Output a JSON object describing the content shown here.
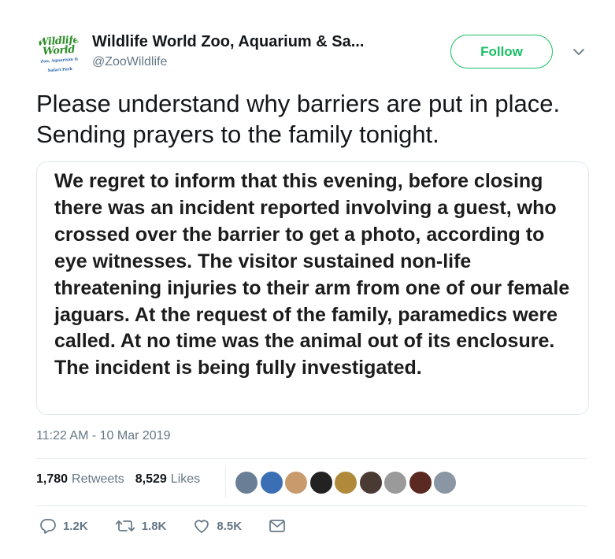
{
  "account": {
    "name": "Wildlife World Zoo, Aquarium & Sa...",
    "handle": "@ZooWildlife",
    "logo_text": "Wildlife World",
    "logo_subtext": "Zoo, Aquarium & Safari Park",
    "logo_color": "#2f8f2a"
  },
  "follow_button": {
    "label": "Follow",
    "color": "#17bf63"
  },
  "tweet": {
    "text": "Please understand why barriers are put in place. Sending prayers to the family tonight.",
    "image_text": "We regret to inform that this evening, before closing there was an incident reported involving a guest, who crossed over the barrier to get a photo, according to eye witnesses. The visitor sustained non-life threatening injuries to their arm from one of our female jaguars. At the request of the family, paramedics were called. At no time was the animal out of its enclosure.  The incident is being fully investigated.",
    "timestamp": "11:22 AM - 10 Mar 2019"
  },
  "stats": {
    "retweets_count": "1,780",
    "retweets_label": "Retweets",
    "likes_count": "8,529",
    "likes_label": "Likes",
    "liker_avatar_colors": [
      "#6a7f95",
      "#3a6fb5",
      "#c89a6c",
      "#222222",
      "#b08a3a",
      "#4a3a34",
      "#9a9a9a",
      "#5a2a22",
      "#8a96a3"
    ]
  },
  "actions": {
    "reply_count": "1.2K",
    "retweet_count": "1.8K",
    "like_count": "8.5K",
    "icons": [
      "reply-icon",
      "retweet-icon",
      "heart-icon",
      "message-icon"
    ]
  }
}
